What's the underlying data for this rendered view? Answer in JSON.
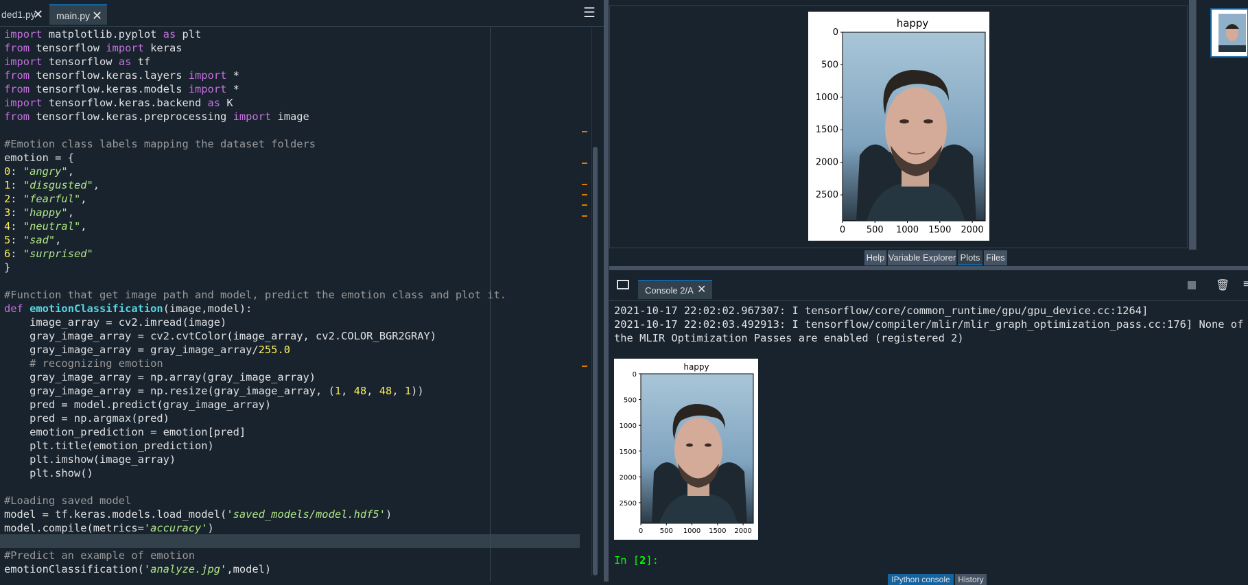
{
  "editor": {
    "tabs": [
      {
        "label": "ded1.py"
      },
      {
        "label": "main.py"
      }
    ],
    "code_lines": [
      "import matplotlib.pyplot as plt",
      "from tensorflow import keras",
      "import tensorflow as tf",
      "from tensorflow.keras.layers import *",
      "from tensorflow.keras.models import *",
      "import tensorflow.keras.backend as K",
      "from tensorflow.keras.preprocessing import image",
      "",
      "#Emotion class labels mapping the dataset folders",
      "emotion = {",
      "0: \"angry\",",
      "1: \"disgusted\",",
      "2: \"fearful\",",
      "3: \"happy\",",
      "4: \"neutral\",",
      "5: \"sad\",",
      "6: \"surprised\"",
      "}",
      "",
      "#Function that get image path and model, predict the emotion class and plot it.",
      "def emotionClassification(image,model):",
      "    image_array = cv2.imread(image)",
      "    gray_image_array = cv2.cvtColor(image_array, cv2.COLOR_BGR2GRAY)",
      "    gray_image_array = gray_image_array/255.0",
      "    # recognizing emotion",
      "    gray_image_array = np.array(gray_image_array)",
      "    gray_image_array = np.resize(gray_image_array, (1, 48, 48, 1))",
      "    pred = model.predict(gray_image_array)",
      "    pred = np.argmax(pred)",
      "    emotion_prediction = emotion[pred]",
      "    plt.title(emotion_prediction)",
      "    plt.imshow(image_array)",
      "    plt.show()",
      "",
      "#Loading saved model",
      "model = tf.keras.models.load_model('saved_models/model.hdf5')",
      "model.compile(metrics='accuracy')",
      "",
      "#Predict an example of emotion",
      "emotionClassification('analyze.jpg',model)"
    ]
  },
  "plots": {
    "figure": {
      "title": "happy",
      "yticks": [
        "0",
        "500",
        "1000",
        "1500",
        "2000",
        "2500"
      ],
      "xticks": [
        "0",
        "500",
        "1000",
        "1500",
        "2000"
      ]
    },
    "pane_tabs": [
      "Help",
      "Variable Explorer",
      "Plots",
      "Files"
    ],
    "active_tab": "Plots"
  },
  "console": {
    "tab_label": "Console 2/A",
    "log_lines": [
      "2021-10-17 22:02:02.967307: I tensorflow/core/common_runtime/gpu/gpu_device.cc:1264]",
      "2021-10-17 22:02:03.492913: I tensorflow/compiler/mlir/mlir_graph_optimization_pass.cc:176] None of",
      "the MLIR Optimization Passes are enabled (registered 2)"
    ],
    "prompt_prefix": "In [",
    "prompt_number": "2",
    "prompt_suffix": "]:",
    "bottom_tabs": [
      "IPython console",
      "History"
    ]
  },
  "colors": {
    "background": "#19232d",
    "keyword": "#c670e0",
    "string": "#b0e686",
    "comment": "#999999",
    "number": "#faed5c",
    "accent": "#1464a0",
    "prompt": "#00ff00"
  }
}
